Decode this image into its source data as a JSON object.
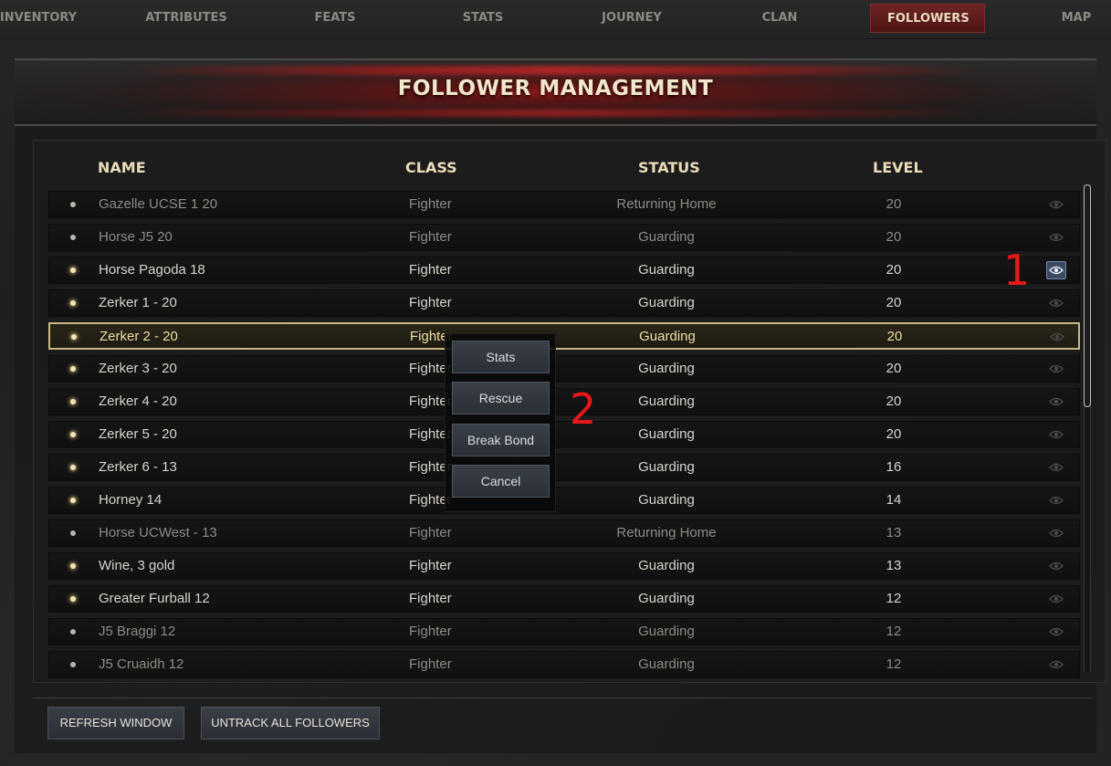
{
  "tabs": [
    {
      "label": "INVENTORY",
      "active": false
    },
    {
      "label": "ATTRIBUTES",
      "active": false
    },
    {
      "label": "FEATS",
      "active": false
    },
    {
      "label": "STATS",
      "active": false
    },
    {
      "label": "JOURNEY",
      "active": false
    },
    {
      "label": "CLAN",
      "active": false
    },
    {
      "label": "FOLLOWERS",
      "active": true
    },
    {
      "label": "MAP",
      "active": false
    }
  ],
  "page": {
    "title": "FOLLOWER MANAGEMENT"
  },
  "columns": {
    "name": "NAME",
    "class": "CLASS",
    "status": "STATUS",
    "level": "LEVEL"
  },
  "followers": [
    {
      "name": "Gazelle UCSE 1 20",
      "class": "Fighter",
      "status": "Returning Home",
      "level": "20",
      "dim": true,
      "tracked": false,
      "selected": false
    },
    {
      "name": "Horse J5 20",
      "class": "Fighter",
      "status": "Guarding",
      "level": "20",
      "dim": true,
      "tracked": false,
      "selected": false
    },
    {
      "name": "Horse Pagoda 18",
      "class": "Fighter",
      "status": "Guarding",
      "level": "20",
      "dim": false,
      "tracked": true,
      "selected": false
    },
    {
      "name": "Zerker 1 - 20",
      "class": "Fighter",
      "status": "Guarding",
      "level": "20",
      "dim": false,
      "tracked": false,
      "selected": false
    },
    {
      "name": "Zerker 2 - 20",
      "class": "Fighter",
      "status": "Guarding",
      "level": "20",
      "dim": false,
      "tracked": false,
      "selected": true
    },
    {
      "name": "Zerker 3 - 20",
      "class": "Fighter",
      "status": "Guarding",
      "level": "20",
      "dim": false,
      "tracked": false,
      "selected": false
    },
    {
      "name": "Zerker 4 - 20",
      "class": "Fighter",
      "status": "Guarding",
      "level": "20",
      "dim": false,
      "tracked": false,
      "selected": false
    },
    {
      "name": "Zerker 5 - 20",
      "class": "Fighter",
      "status": "Guarding",
      "level": "20",
      "dim": false,
      "tracked": false,
      "selected": false
    },
    {
      "name": "Zerker 6 - 13",
      "class": "Fighter",
      "status": "Guarding",
      "level": "16",
      "dim": false,
      "tracked": false,
      "selected": false
    },
    {
      "name": "Horney 14",
      "class": "Fighter",
      "status": "Guarding",
      "level": "14",
      "dim": false,
      "tracked": false,
      "selected": false
    },
    {
      "name": "Horse UCWest - 13",
      "class": "Fighter",
      "status": "Returning Home",
      "level": "13",
      "dim": true,
      "tracked": false,
      "selected": false
    },
    {
      "name": "Wine, 3 gold",
      "class": "Fighter",
      "status": "Guarding",
      "level": "13",
      "dim": false,
      "tracked": false,
      "selected": false
    },
    {
      "name": "Greater Furball 12",
      "class": "Fighter",
      "status": "Guarding",
      "level": "12",
      "dim": false,
      "tracked": false,
      "selected": false
    },
    {
      "name": "J5 Braggi 12",
      "class": "Fighter",
      "status": "Guarding",
      "level": "12",
      "dim": true,
      "tracked": false,
      "selected": false
    },
    {
      "name": "J5 Cruaidh 12",
      "class": "Fighter",
      "status": "Guarding",
      "level": "12",
      "dim": true,
      "tracked": false,
      "selected": false
    }
  ],
  "context_menu": {
    "items": [
      "Stats",
      "Rescue",
      "Break Bond",
      "Cancel"
    ]
  },
  "annotations": {
    "marker_1": "1",
    "marker_2": "2"
  },
  "footer": {
    "refresh_label": "REFRESH WINDOW",
    "untrack_label": "UNTRACK ALL FOLLOWERS"
  },
  "colors": {
    "accent_tab": "#6e2323",
    "header_text": "#eadcb9",
    "selection_border": "#c8b684",
    "annotation": "#e8171a",
    "track_on": "#3b4a63"
  },
  "icons": {
    "track": "eye-icon",
    "status_dot": "dot-icon"
  }
}
